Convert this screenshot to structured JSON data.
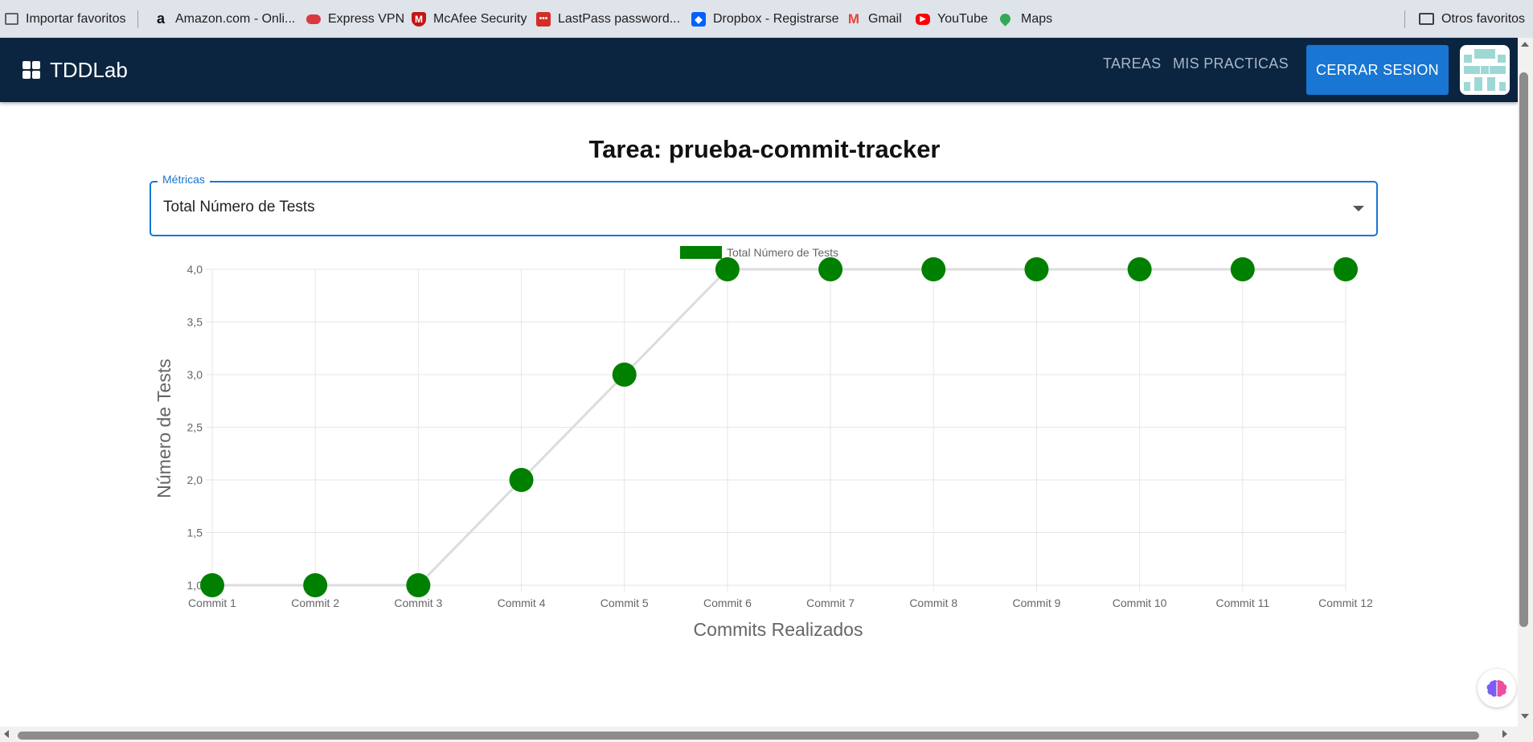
{
  "bookmarks": [
    {
      "label": "Importar favoritos",
      "icon": "import-icon",
      "color": "#5f6368"
    },
    {
      "label": "Amazon.com - Onli...",
      "icon": "amazon-icon",
      "color": "#111111"
    },
    {
      "label": "Express VPN",
      "icon": "expressvpn-icon",
      "color": "#da3940"
    },
    {
      "label": "McAfee Security",
      "icon": "mcafee-icon",
      "color": "#c01818"
    },
    {
      "label": "LastPass password...",
      "icon": "lastpass-icon",
      "color": "#d32d27"
    },
    {
      "label": "Dropbox - Registrarse",
      "icon": "dropbox-icon",
      "color": "#0061fe"
    },
    {
      "label": "Gmail",
      "icon": "gmail-icon",
      "color": "#ea4335"
    },
    {
      "label": "YouTube",
      "icon": "youtube-icon",
      "color": "#ff0000"
    },
    {
      "label": "Maps",
      "icon": "maps-icon",
      "color": "#34a853"
    }
  ],
  "other_bookmarks": "Otros favoritos",
  "app": {
    "brand": "TDDLab",
    "nav": [
      "TAREAS",
      "MIS PRACTICAS"
    ],
    "logout": "CERRAR SESION",
    "header_color": "#0b2541",
    "accent": "#1976d2"
  },
  "page": {
    "title": "Tarea: prueba-commit-tracker",
    "select_label": "Métricas",
    "select_value": "Total Número de Tests"
  },
  "chart_data": {
    "type": "line",
    "categories": [
      "Commit 1",
      "Commit 2",
      "Commit 3",
      "Commit 4",
      "Commit 5",
      "Commit 6",
      "Commit 7",
      "Commit 8",
      "Commit 9",
      "Commit 10",
      "Commit 11",
      "Commit 12"
    ],
    "series": [
      {
        "name": "Total Número de Tests",
        "values": [
          1,
          1,
          1,
          2,
          3,
          4,
          4,
          4,
          4,
          4,
          4,
          4
        ],
        "color": "#008000",
        "line_color": "#dcdcdc"
      }
    ],
    "xlabel": "Commits Realizados",
    "ylabel": "Número de Tests",
    "ylim": [
      1,
      4
    ],
    "yticks": [
      "1,0",
      "1,5",
      "2,0",
      "2,5",
      "3,0",
      "3,5",
      "4,0"
    ],
    "grid": true,
    "legend": "top-center"
  }
}
